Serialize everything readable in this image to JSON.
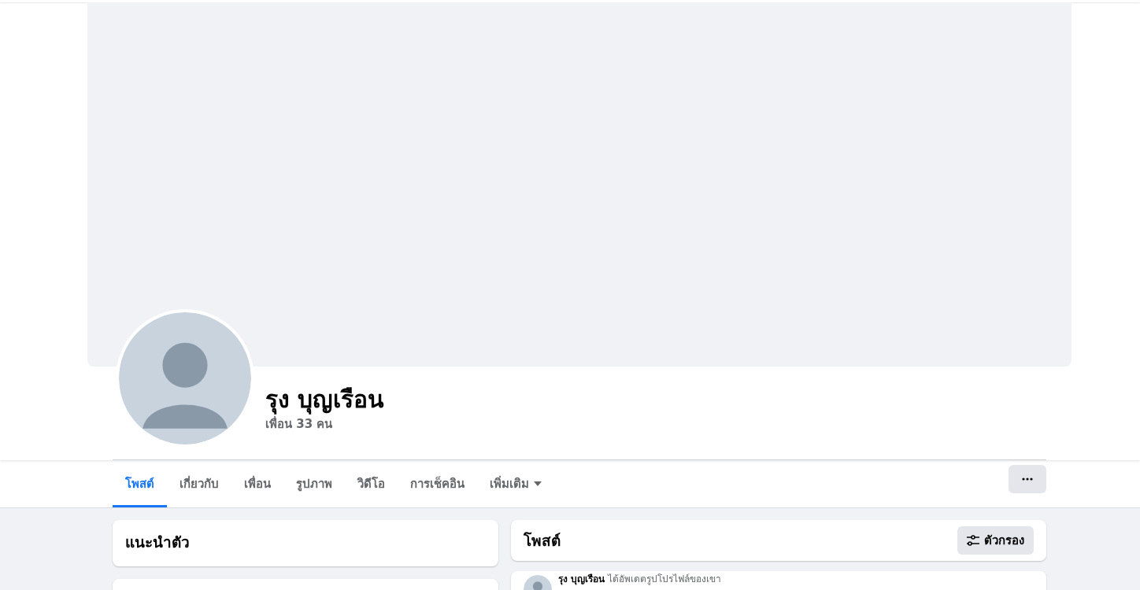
{
  "profile": {
    "name": "รุง บุญเรือน",
    "friends": "เพื่อน 33 คน"
  },
  "tabs": [
    {
      "label": "โพสต์",
      "selected": true,
      "kind": "link"
    },
    {
      "label": "เกี่ยวกับ",
      "selected": false,
      "kind": "link"
    },
    {
      "label": "เพื่อน",
      "selected": false,
      "kind": "link"
    },
    {
      "label": "รูปภาพ",
      "selected": false,
      "kind": "link"
    },
    {
      "label": "วิดีโอ",
      "selected": false,
      "kind": "link"
    },
    {
      "label": "การเช็คอิน",
      "selected": false,
      "kind": "link"
    },
    {
      "label": "เพิ่มเติม",
      "selected": false,
      "kind": "menu"
    }
  ],
  "intro_card": {
    "title": "แนะนำตัว"
  },
  "posts_card": {
    "title": "โพสต์",
    "filter_button": "ตัวกรอง"
  },
  "post": {
    "headline": "**รุง บุญเรือน** ได้อัพเดตรูปโปรไฟล์ของเขา"
  }
}
